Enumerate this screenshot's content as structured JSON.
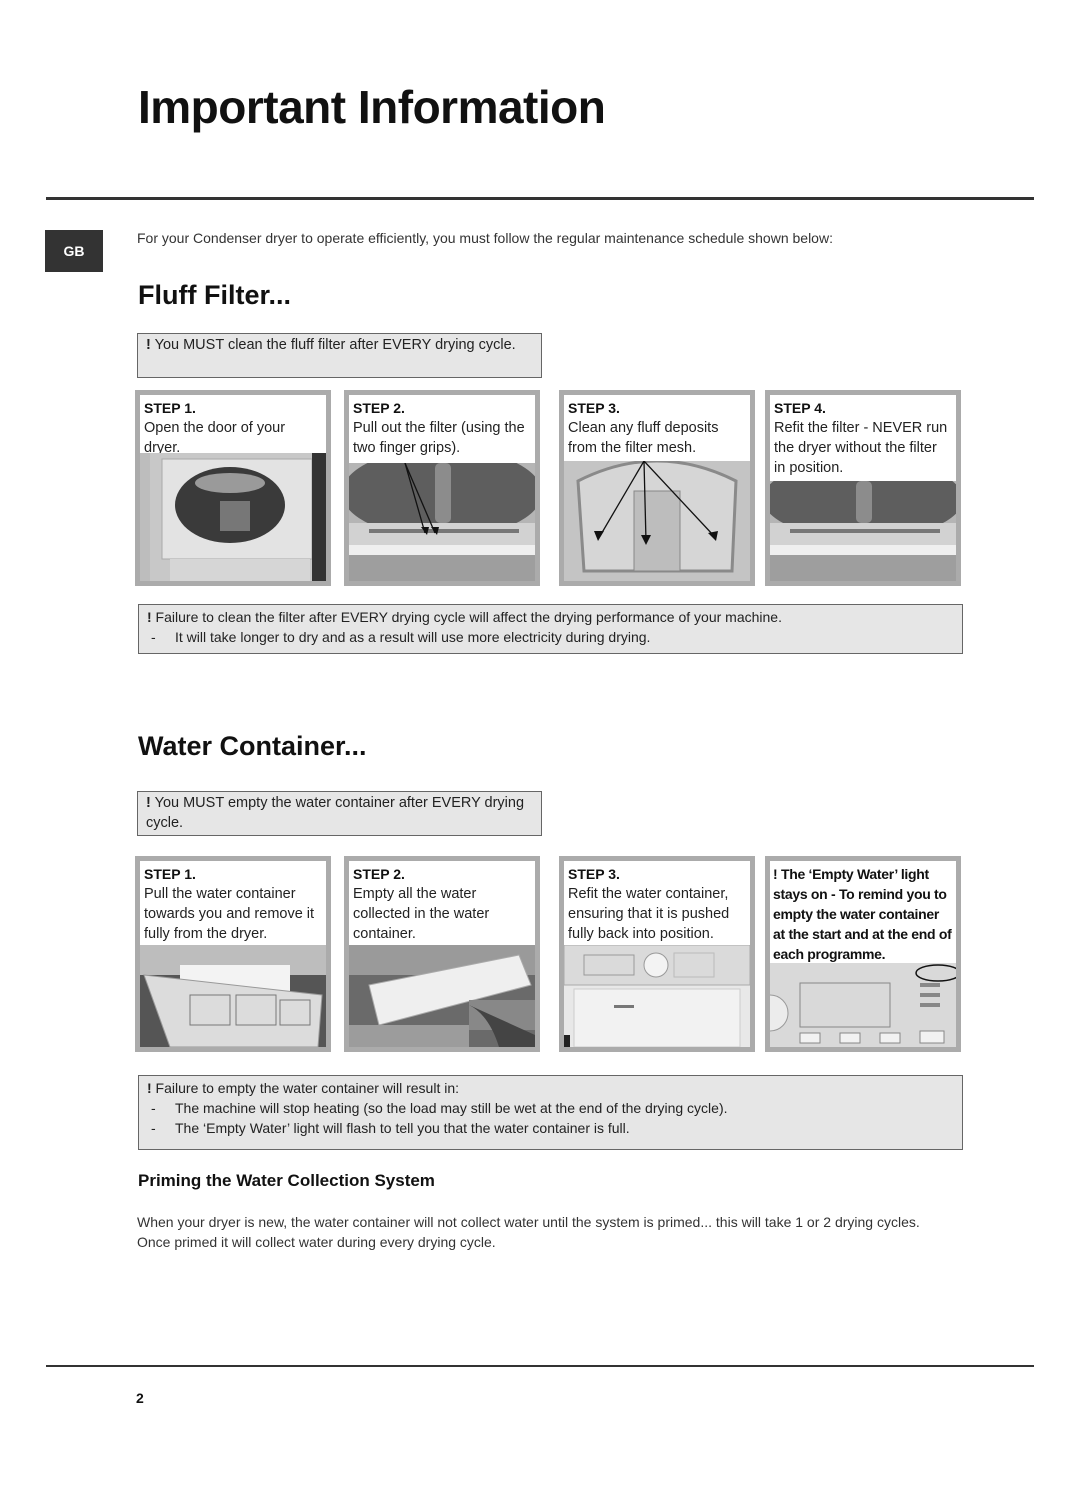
{
  "page": {
    "title": "Important Information",
    "language_badge": "GB",
    "intro": "For your Condenser dryer to operate efficiently, you must follow the regular maintenance schedule shown below:",
    "page_number": "2"
  },
  "fluff_filter": {
    "title": "Fluff Filter...",
    "warning": {
      "bang": "!",
      "text": " You MUST clean the fluff filter after EVERY drying cycle."
    },
    "steps": [
      {
        "label": "STEP 1.",
        "text": "Open the door of your dryer.",
        "photo": "dryer-door-open-photo"
      },
      {
        "label": "STEP 2.",
        "text": "Pull out the filter (using the two finger grips).",
        "photo": "filter-finger-grips-photo"
      },
      {
        "label": "STEP 3.",
        "text": "Clean any fluff deposits from the filter mesh.",
        "photo": "filter-mesh-photo"
      },
      {
        "label": "STEP 4.",
        "text": "Refit the filter - NEVER run the dryer without the filter in position.",
        "photo": "filter-refitted-photo"
      }
    ],
    "failure": {
      "bang": "!",
      "text": " Failure to clean the filter after EVERY drying cycle will affect the drying performance of your machine.",
      "items": [
        "It will take longer to dry and as a result will use more electricity during drying."
      ]
    }
  },
  "water_container": {
    "title": "Water Container...",
    "warning": {
      "bang": "!",
      "text": " You MUST empty the water container after EVERY drying cycle."
    },
    "steps": [
      {
        "label": "STEP 1.",
        "text": "Pull the water container towards you and remove it fully from the dryer.",
        "photo": "container-removal-photo"
      },
      {
        "label": "STEP 2.",
        "text": "Empty all the water collected in the water container.",
        "photo": "container-emptying-photo"
      },
      {
        "label": "STEP 3.",
        "text": "Refit the water container, ensuring that it is pushed fully back into position.",
        "photo": "dryer-front-photo"
      }
    ],
    "light_note": {
      "bang": "!",
      "text": " The ‘Empty Water’ light stays on - To remind you to empty the water container at the start and at the end of each programme.",
      "photo": "control-panel-photo"
    },
    "failure": {
      "bang": "!",
      "text": " Failure to empty the water container will result in:",
      "items": [
        "The machine will stop heating (so the load may still be wet at the end of the drying cycle).",
        "The ‘Empty Water’ light will flash to tell you that the water container is full."
      ]
    }
  },
  "priming": {
    "title": "Priming the Water Collection System",
    "text": "When your dryer is new, the water container will not collect water until the system is primed... this will take 1 or 2 drying cycles. Once primed it will collect water during every drying cycle."
  }
}
